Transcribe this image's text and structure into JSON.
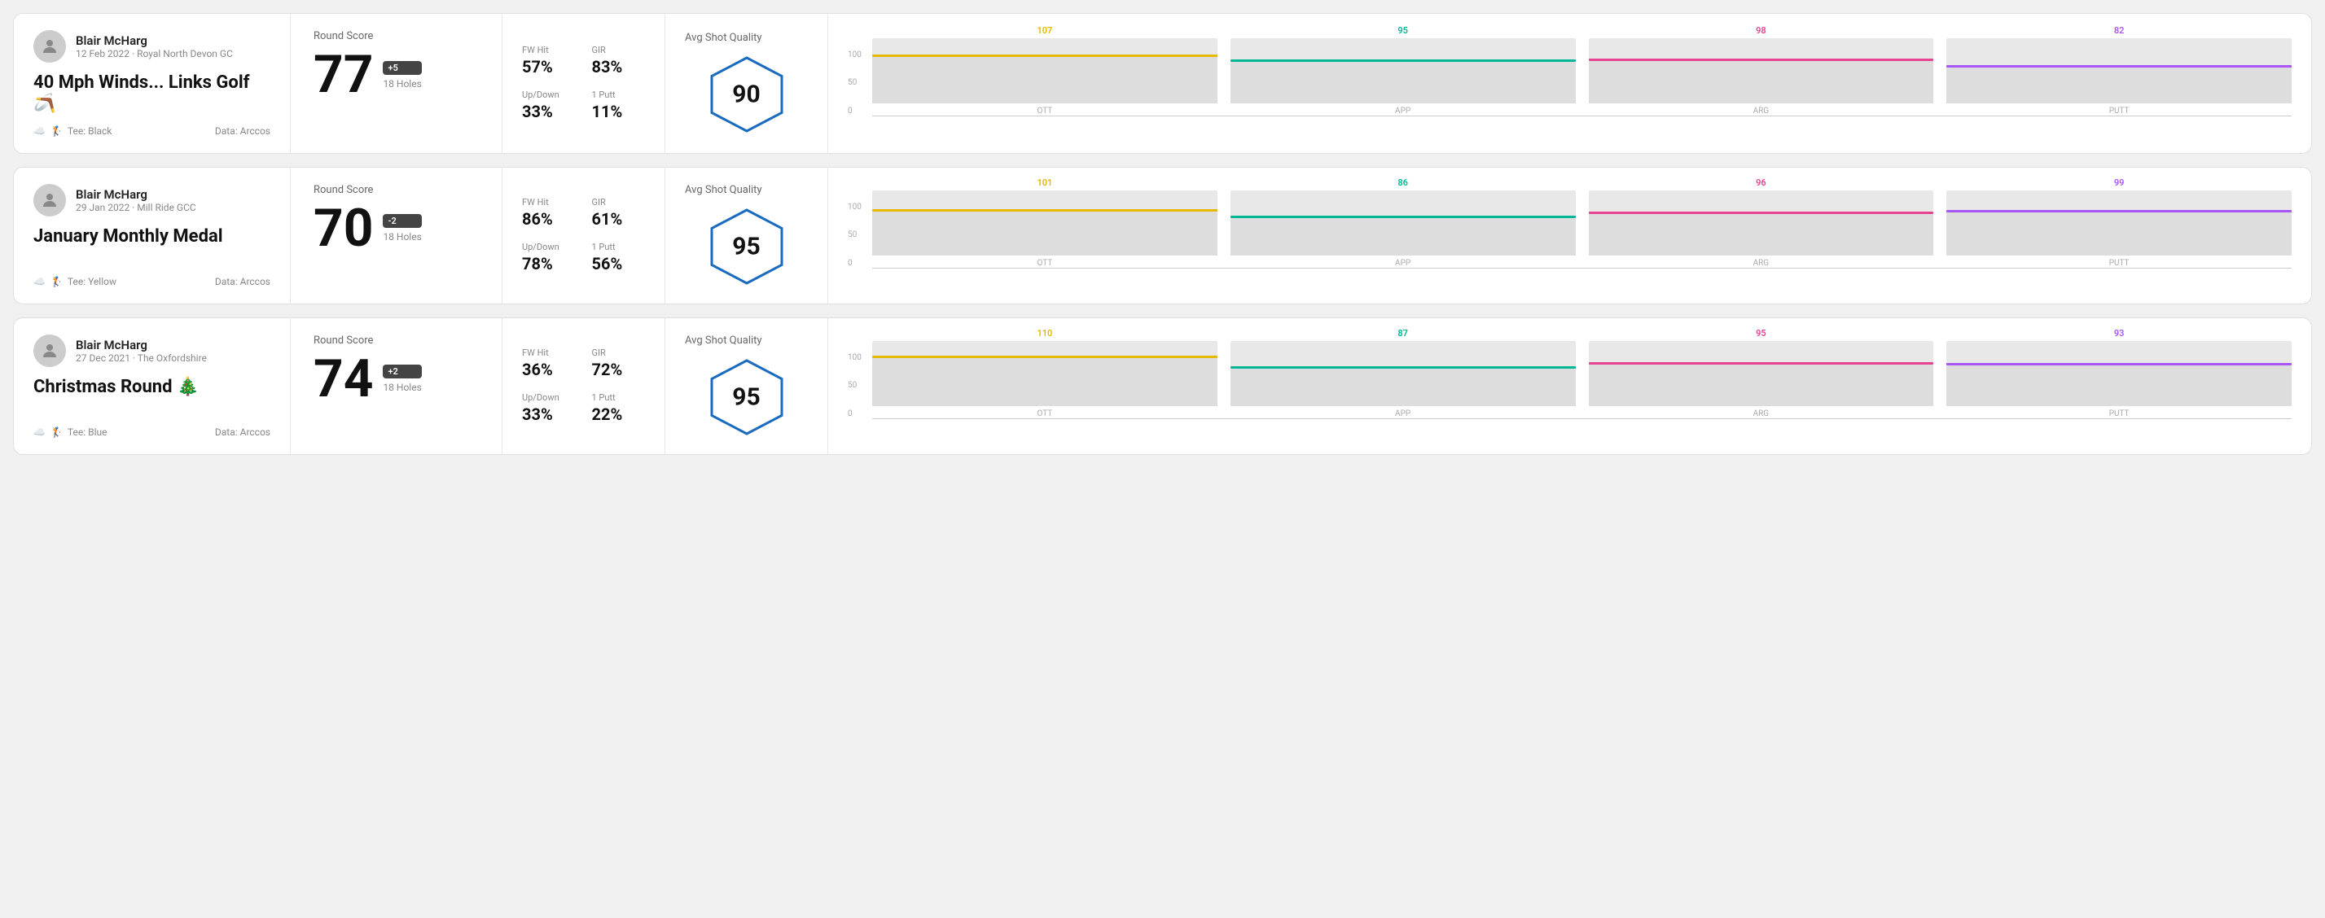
{
  "rounds": [
    {
      "id": "round1",
      "player": "Blair McHarg",
      "date": "12 Feb 2022 · Royal North Devon GC",
      "title": "40 Mph Winds... Links Golf 🪃",
      "tee": "Black",
      "data_source": "Data: Arccos",
      "round_score_label": "Round Score",
      "score": "77",
      "score_diff": "+5",
      "holes": "18 Holes",
      "fw_hit_label": "FW Hit",
      "fw_hit": "57%",
      "gir_label": "GIR",
      "gir": "83%",
      "updown_label": "Up/Down",
      "updown": "33%",
      "oneputt_label": "1 Putt",
      "oneputt": "11%",
      "avg_shot_label": "Avg Shot Quality",
      "quality_score": "90",
      "chart": {
        "bars": [
          {
            "label": "OTT",
            "value": 107,
            "color": "#e6b800",
            "max": 150
          },
          {
            "label": "APP",
            "value": 95,
            "color": "#00b894",
            "max": 150
          },
          {
            "label": "ARG",
            "value": 98,
            "color": "#e84393",
            "max": 150
          },
          {
            "label": "PUTT",
            "value": 82,
            "color": "#a855f7",
            "max": 150
          }
        ]
      }
    },
    {
      "id": "round2",
      "player": "Blair McHarg",
      "date": "29 Jan 2022 · Mill Ride GCC",
      "title": "January Monthly Medal",
      "tee": "Yellow",
      "data_source": "Data: Arccos",
      "round_score_label": "Round Score",
      "score": "70",
      "score_diff": "-2",
      "holes": "18 Holes",
      "fw_hit_label": "FW Hit",
      "fw_hit": "86%",
      "gir_label": "GIR",
      "gir": "61%",
      "updown_label": "Up/Down",
      "updown": "78%",
      "oneputt_label": "1 Putt",
      "oneputt": "56%",
      "avg_shot_label": "Avg Shot Quality",
      "quality_score": "95",
      "chart": {
        "bars": [
          {
            "label": "OTT",
            "value": 101,
            "color": "#e6b800",
            "max": 150
          },
          {
            "label": "APP",
            "value": 86,
            "color": "#00b894",
            "max": 150
          },
          {
            "label": "ARG",
            "value": 96,
            "color": "#e84393",
            "max": 150
          },
          {
            "label": "PUTT",
            "value": 99,
            "color": "#a855f7",
            "max": 150
          }
        ]
      }
    },
    {
      "id": "round3",
      "player": "Blair McHarg",
      "date": "27 Dec 2021 · The Oxfordshire",
      "title": "Christmas Round 🎄",
      "tee": "Blue",
      "data_source": "Data: Arccos",
      "round_score_label": "Round Score",
      "score": "74",
      "score_diff": "+2",
      "holes": "18 Holes",
      "fw_hit_label": "FW Hit",
      "fw_hit": "36%",
      "gir_label": "GIR",
      "gir": "72%",
      "updown_label": "Up/Down",
      "updown": "33%",
      "oneputt_label": "1 Putt",
      "oneputt": "22%",
      "avg_shot_label": "Avg Shot Quality",
      "quality_score": "95",
      "chart": {
        "bars": [
          {
            "label": "OTT",
            "value": 110,
            "color": "#e6b800",
            "max": 150
          },
          {
            "label": "APP",
            "value": 87,
            "color": "#00b894",
            "max": 150
          },
          {
            "label": "ARG",
            "value": 95,
            "color": "#e84393",
            "max": 150
          },
          {
            "label": "PUTT",
            "value": 93,
            "color": "#a855f7",
            "max": 150
          }
        ]
      }
    }
  ],
  "y_axis_labels": [
    "100",
    "50",
    "0"
  ]
}
